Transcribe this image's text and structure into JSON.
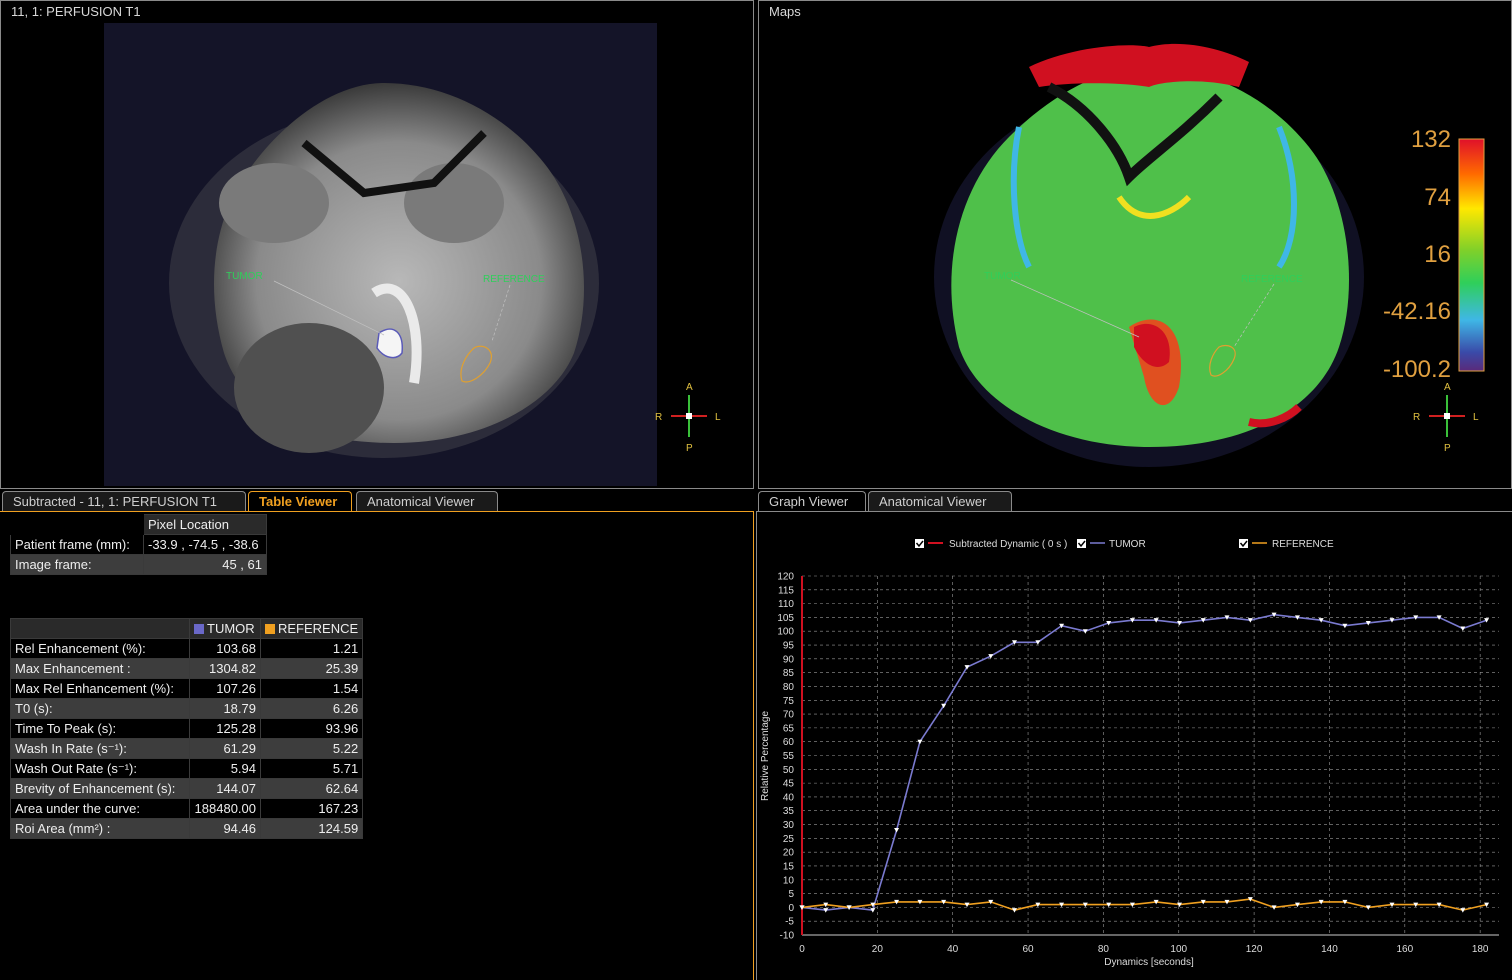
{
  "panes": {
    "top_left_title": "11, 1: PERFUSION T1",
    "top_right_title": "Maps"
  },
  "roi_labels": {
    "tumor": "TUMOR",
    "reference": "REFERENCE"
  },
  "orientation": {
    "a": "A",
    "p": "P",
    "r": "R",
    "l": "L"
  },
  "colorbar": {
    "ticks": [
      "132",
      "74",
      "16",
      "-42.16",
      "-100.2"
    ],
    "colors": [
      "#e0102a",
      "#ff6a00",
      "#ffe800",
      "#7fd02a",
      "#2fcf5a",
      "#3fb7e6",
      "#3a4aa8",
      "#5a2a7a"
    ]
  },
  "left_tabs": [
    "Subtracted - 11, 1: PERFUSION T1",
    "Table Viewer",
    "Anatomical Viewer"
  ],
  "right_tabs": [
    "Graph Viewer",
    "Anatomical Viewer"
  ],
  "pixel_table": {
    "header": "Pixel Location",
    "rows": [
      {
        "label": "Patient frame (mm):",
        "value": "-33.9 , -74.5 , -38.6"
      },
      {
        "label": "Image frame:",
        "value": "45 , 61"
      }
    ]
  },
  "roi_table": {
    "columns": [
      "TUMOR",
      "REFERENCE"
    ],
    "column_colors": [
      "#6a68c8",
      "#f0a020"
    ],
    "rows": [
      {
        "label": "Rel Enhancement  (%):",
        "tumor": "103.68",
        "reference": "1.21"
      },
      {
        "label": "Max Enhancement :",
        "tumor": "1304.82",
        "reference": "25.39"
      },
      {
        "label": "Max Rel Enhancement (%):",
        "tumor": "107.26",
        "reference": "1.54"
      },
      {
        "label": "T0 (s):",
        "tumor": "18.79",
        "reference": "6.26"
      },
      {
        "label": "Time To Peak  (s):",
        "tumor": "125.28",
        "reference": "93.96"
      },
      {
        "label": "Wash In Rate (s⁻¹):",
        "tumor": "61.29",
        "reference": "5.22"
      },
      {
        "label": "Wash Out Rate (s⁻¹):",
        "tumor": "5.94",
        "reference": "5.71"
      },
      {
        "label": "Brevity of Enhancement (s):",
        "tumor": "144.07",
        "reference": "62.64"
      },
      {
        "label": "Area under the curve:",
        "tumor": "188480.00",
        "reference": "167.23"
      },
      {
        "label": "Roi Area (mm²) :",
        "tumor": "94.46",
        "reference": "124.59"
      }
    ]
  },
  "chart_data": {
    "type": "line",
    "xlabel": "Dynamics [seconds]",
    "ylabel": "Relative Percentage",
    "xlim": [
      0,
      185
    ],
    "ylim": [
      -10,
      120
    ],
    "xticks": [
      0,
      20,
      40,
      60,
      80,
      100,
      120,
      140,
      160,
      180
    ],
    "yticks": [
      -10,
      -5,
      0,
      5,
      10,
      15,
      20,
      25,
      30,
      35,
      40,
      45,
      50,
      55,
      60,
      65,
      70,
      75,
      80,
      85,
      90,
      95,
      100,
      105,
      110,
      115,
      120
    ],
    "grid": true,
    "legend_position": "top",
    "legend": [
      "Subtracted Dynamic ( 0 s )",
      "TUMOR",
      "REFERENCE"
    ],
    "marker_line": {
      "name": "Subtracted Dynamic ( 0 s )",
      "x": 0,
      "color": "#d01020"
    },
    "series": [
      {
        "name": "TUMOR",
        "color": "#7a7ad0",
        "x": [
          0,
          6.3,
          12.5,
          18.8,
          25.1,
          31.3,
          37.6,
          43.8,
          50.1,
          56.4,
          62.6,
          68.9,
          75.2,
          81.4,
          87.7,
          94.0,
          100.2,
          106.5,
          112.8,
          119.0,
          125.3,
          131.5,
          137.8,
          144.1,
          150.3,
          156.6,
          162.9,
          169.1,
          175.4,
          181.7
        ],
        "y": [
          0,
          -1,
          0,
          -1,
          28,
          60,
          73,
          87,
          91,
          96,
          96,
          102,
          100,
          103,
          104,
          104,
          103,
          104,
          105,
          104,
          106,
          105,
          104,
          102,
          103,
          104,
          105,
          105,
          101,
          104
        ]
      },
      {
        "name": "REFERENCE",
        "color": "#f0a020",
        "x": [
          0,
          6.3,
          12.5,
          18.8,
          25.1,
          31.3,
          37.6,
          43.8,
          50.1,
          56.4,
          62.6,
          68.9,
          75.2,
          81.4,
          87.7,
          94.0,
          100.2,
          106.5,
          112.8,
          119.0,
          125.3,
          131.5,
          137.8,
          144.1,
          150.3,
          156.6,
          162.9,
          169.1,
          175.4,
          181.7
        ],
        "y": [
          0,
          1,
          0,
          1,
          2,
          2,
          2,
          1,
          2,
          -1,
          1,
          1,
          1,
          1,
          1,
          2,
          1,
          2,
          2,
          3,
          0,
          1,
          2,
          2,
          0,
          1,
          1,
          1,
          -1,
          1
        ]
      }
    ]
  }
}
